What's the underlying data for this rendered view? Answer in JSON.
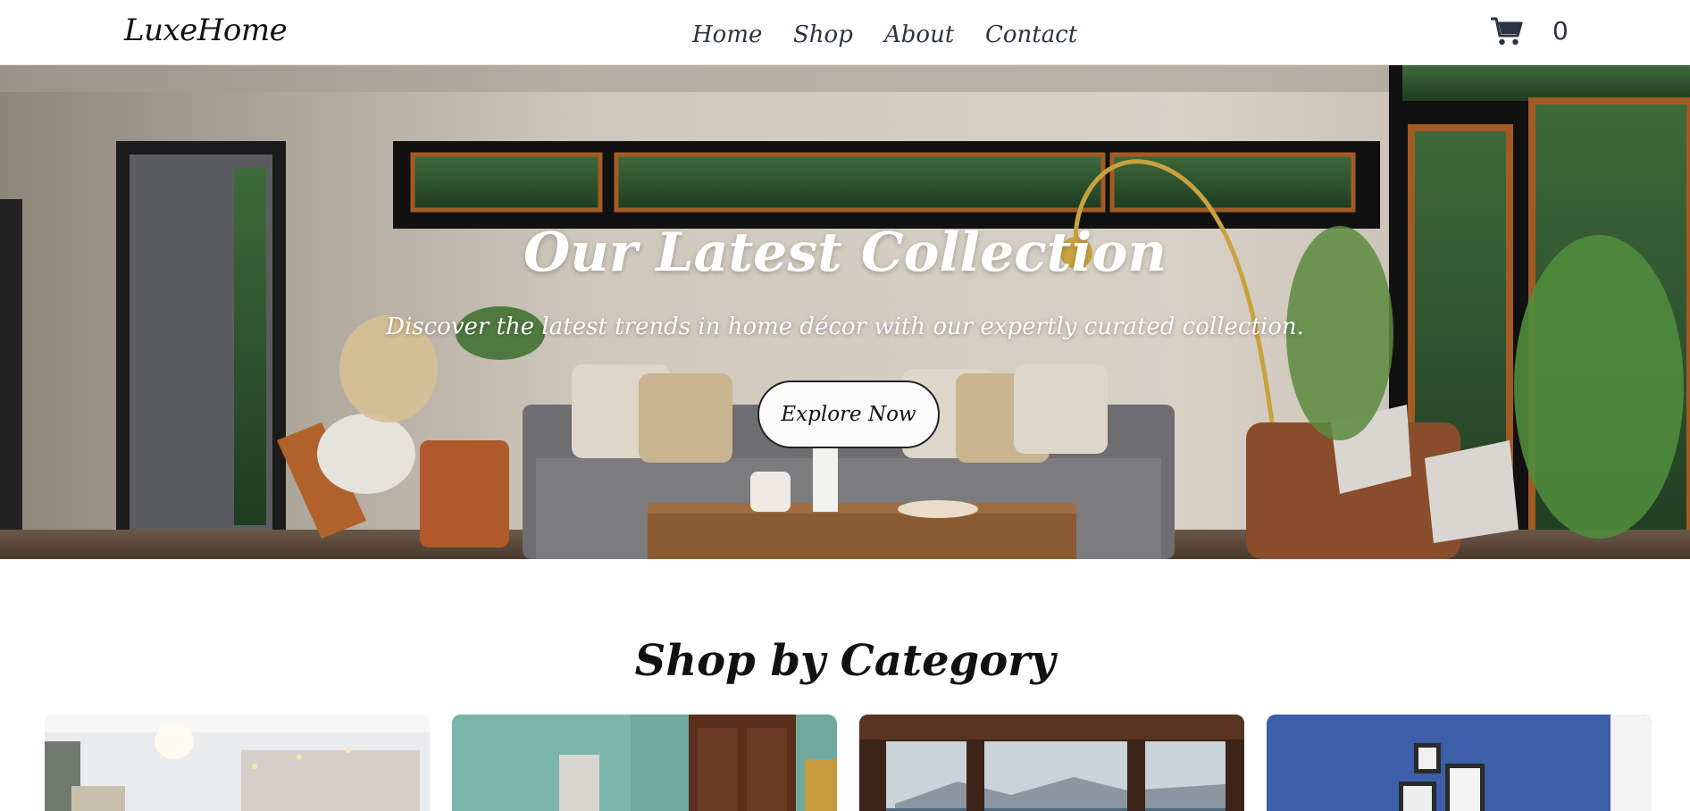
{
  "header": {
    "logo": "LuxeHome",
    "nav": [
      {
        "label": "Home"
      },
      {
        "label": "Shop"
      },
      {
        "label": "About"
      },
      {
        "label": "Contact"
      }
    ],
    "cart": {
      "icon": "cart-icon",
      "count": "0"
    }
  },
  "hero": {
    "title": "Our Latest Collection",
    "subtitle": "Discover the latest trends in home décor with our expertly curated collection.",
    "cta_label": "Explore Now"
  },
  "categories": {
    "title": "Shop by Category",
    "cards": [
      {
        "image": "bright-living-room-image"
      },
      {
        "image": "teal-room-wardrobe-image"
      },
      {
        "image": "window-seaside-view-image"
      },
      {
        "image": "blue-wall-shelves-image"
      }
    ]
  },
  "colors": {
    "text": "#111111",
    "nav_text": "#2b3442",
    "button_bg": "#fafafa",
    "background": "#ffffff"
  }
}
